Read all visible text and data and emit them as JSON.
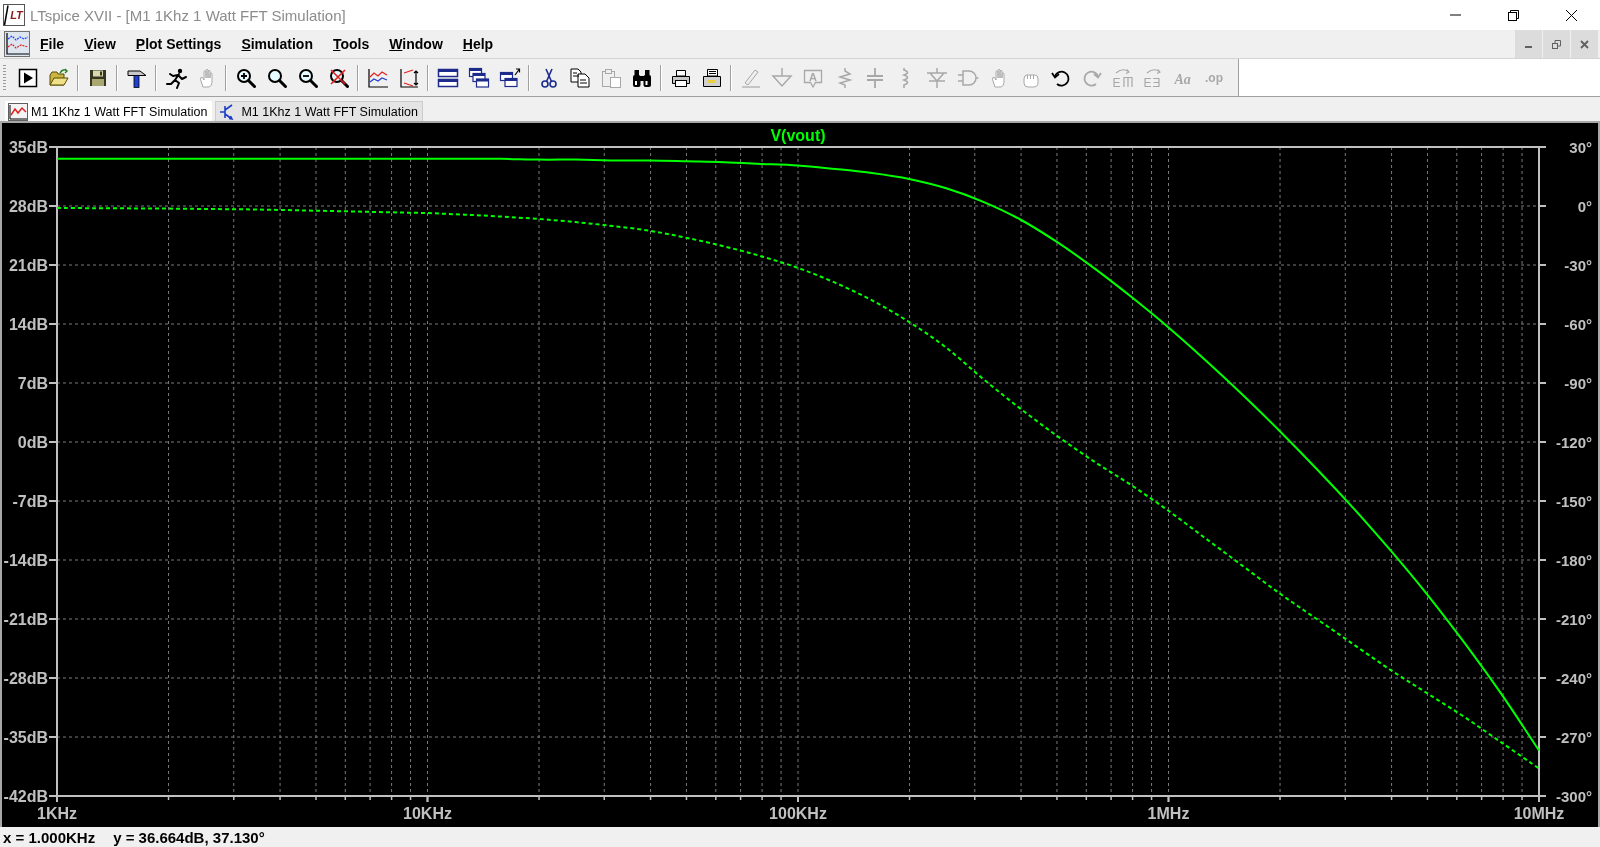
{
  "window": {
    "logo": "LT",
    "title": "LTspice XVII - [M1 1Khz 1 Watt FFT Simulation]"
  },
  "menu": [
    "File",
    "View",
    "Plot Settings",
    "Simulation",
    "Tools",
    "Window",
    "Help"
  ],
  "toolbar": [
    {
      "buttons": [
        {
          "kind": "run",
          "disabled": false
        },
        {
          "kind": "open",
          "disabled": false
        }
      ]
    },
    {
      "buttons": [
        {
          "kind": "save",
          "disabled": false
        }
      ]
    },
    {
      "buttons": [
        {
          "kind": "hammer",
          "disabled": false
        }
      ]
    },
    {
      "buttons": [
        {
          "kind": "halt",
          "disabled": false
        },
        {
          "kind": "pause",
          "disabled": true
        }
      ]
    },
    {
      "buttons": [
        {
          "kind": "zoom-in",
          "disabled": false
        },
        {
          "kind": "zoom-box",
          "disabled": false
        },
        {
          "kind": "zoom-out",
          "disabled": false
        },
        {
          "kind": "zoom-cancel",
          "disabled": false
        }
      ]
    },
    {
      "buttons": [
        {
          "kind": "autorange",
          "disabled": false
        },
        {
          "kind": "scale",
          "disabled": false
        }
      ]
    },
    {
      "buttons": [
        {
          "kind": "tile-h",
          "disabled": false
        },
        {
          "kind": "cascade",
          "disabled": false
        },
        {
          "kind": "tile-v",
          "disabled": false
        }
      ]
    },
    {
      "buttons": [
        {
          "kind": "cut",
          "disabled": false
        },
        {
          "kind": "copy",
          "disabled": false
        },
        {
          "kind": "paste",
          "disabled": true
        },
        {
          "kind": "find",
          "disabled": false
        }
      ]
    },
    {
      "buttons": [
        {
          "kind": "print",
          "disabled": false
        },
        {
          "kind": "print-setup",
          "disabled": false
        }
      ]
    },
    {
      "buttons": [
        {
          "kind": "wire",
          "disabled": true
        },
        {
          "kind": "ground",
          "disabled": true
        },
        {
          "kind": "label",
          "glyph": "A",
          "disabled": true
        },
        {
          "kind": "resistor",
          "disabled": true
        },
        {
          "kind": "capacitor",
          "disabled": true
        },
        {
          "kind": "inductor",
          "disabled": true
        },
        {
          "kind": "diode",
          "disabled": true
        },
        {
          "kind": "component",
          "disabled": true
        },
        {
          "kind": "move",
          "disabled": true
        },
        {
          "kind": "drag",
          "disabled": true
        },
        {
          "kind": "undo",
          "disabled": false
        },
        {
          "kind": "redo",
          "disabled": true
        },
        {
          "kind": "rotate",
          "glyph": "E",
          "disabled": true
        },
        {
          "kind": "mirror",
          "glyph": "EƎ",
          "disabled": true
        },
        {
          "kind": "text",
          "glyph": "Aa",
          "disabled": true
        },
        {
          "kind": "spice-directive",
          "glyph": ".op",
          "disabled": true
        }
      ]
    }
  ],
  "tabs": [
    {
      "label": "M1 1Khz 1 Watt FFT Simulation",
      "kind": "plot",
      "selected": true
    },
    {
      "label": "M1 1Khz 1 Watt FFT Simulation",
      "kind": "schematic",
      "selected": false
    }
  ],
  "plot": {
    "chart_data": {
      "type": "line",
      "title": "V(vout)",
      "grid": true,
      "categories": [
        "1KHz",
        null,
        null,
        null,
        null,
        null,
        null,
        null,
        null,
        null,
        "10KHz",
        null,
        null,
        null,
        null,
        null,
        null,
        null,
        null,
        null,
        "100KHz",
        null,
        null,
        null,
        null,
        null,
        null,
        null,
        null,
        null,
        "1MHz",
        null,
        null,
        null,
        null,
        null,
        null,
        null,
        null,
        null,
        "10MHz"
      ],
      "series": [
        {
          "color": "#00ff00",
          "line_style": "solid",
          "values": [
            33.6,
            33.6,
            33.6,
            33.6,
            33.6,
            33.6,
            33.6,
            33.6,
            33.6,
            33.6,
            33.6,
            33.6,
            33.6,
            33.5,
            33.5,
            33.4,
            33.4,
            33.3,
            33.2,
            33.0,
            32.8,
            32.4,
            31.9,
            31.2,
            30.1,
            28.5,
            26.4,
            23.7,
            20.6,
            17.2,
            13.6,
            9.7,
            5.6,
            1.3,
            -3.2,
            -7.9,
            -12.9,
            -18.2,
            -23.9,
            -30.0,
            -36.6
          ]
        },
        {
          "color": "#00ff00",
          "line_style": "dashed",
          "axis": "y2",
          "values": [
            -1.0,
            -1.1,
            -1.2,
            -1.3,
            -1.5,
            -1.7,
            -2.0,
            -2.4,
            -2.8,
            -3.2,
            -3.6,
            -4.4,
            -5.4,
            -6.6,
            -8.2,
            -10.2,
            -12.6,
            -16.2,
            -20.5,
            -25.5,
            -31.5,
            -39,
            -48,
            -59,
            -72,
            -88,
            -103,
            -117,
            -130,
            -142,
            -155,
            -169,
            -183,
            -197,
            -210,
            -223,
            -236,
            -248,
            -260,
            -273,
            -286
          ]
        }
      ],
      "ylim": [
        -42,
        35
      ],
      "y2lim": [
        -300,
        30
      ],
      "yticks": [
        {
          "value": 35,
          "label": "35dB"
        },
        {
          "value": 28,
          "label": "28dB"
        },
        {
          "value": 21,
          "label": "21dB"
        },
        {
          "value": 14,
          "label": "14dB"
        },
        {
          "value": 7,
          "label": "7dB"
        },
        {
          "value": 0,
          "label": "0dB"
        },
        {
          "value": -7,
          "label": "-7dB"
        },
        {
          "value": -14,
          "label": "-14dB"
        },
        {
          "value": -21,
          "label": "-21dB"
        },
        {
          "value": -28,
          "label": "-28dB"
        },
        {
          "value": -35,
          "label": "-35dB"
        },
        {
          "value": -42,
          "label": "-42dB"
        }
      ],
      "y2ticks": [
        {
          "value": 30,
          "label": "30°"
        },
        {
          "value": 0,
          "label": "0°"
        },
        {
          "value": -30,
          "label": "-30°"
        },
        {
          "value": -60,
          "label": "-60°"
        },
        {
          "value": -90,
          "label": "-90°"
        },
        {
          "value": -120,
          "label": "-120°"
        },
        {
          "value": -150,
          "label": "-150°"
        },
        {
          "value": -180,
          "label": "-180°"
        },
        {
          "value": -210,
          "label": "-210°"
        },
        {
          "value": -240,
          "label": "-240°"
        },
        {
          "value": -270,
          "label": "-270°"
        },
        {
          "value": -300,
          "label": "-300°"
        }
      ]
    }
  },
  "status_bar": {
    "cursor_x": "x = 1.000KHz",
    "cursor_y": "y = 36.664dB, 37.130°"
  }
}
